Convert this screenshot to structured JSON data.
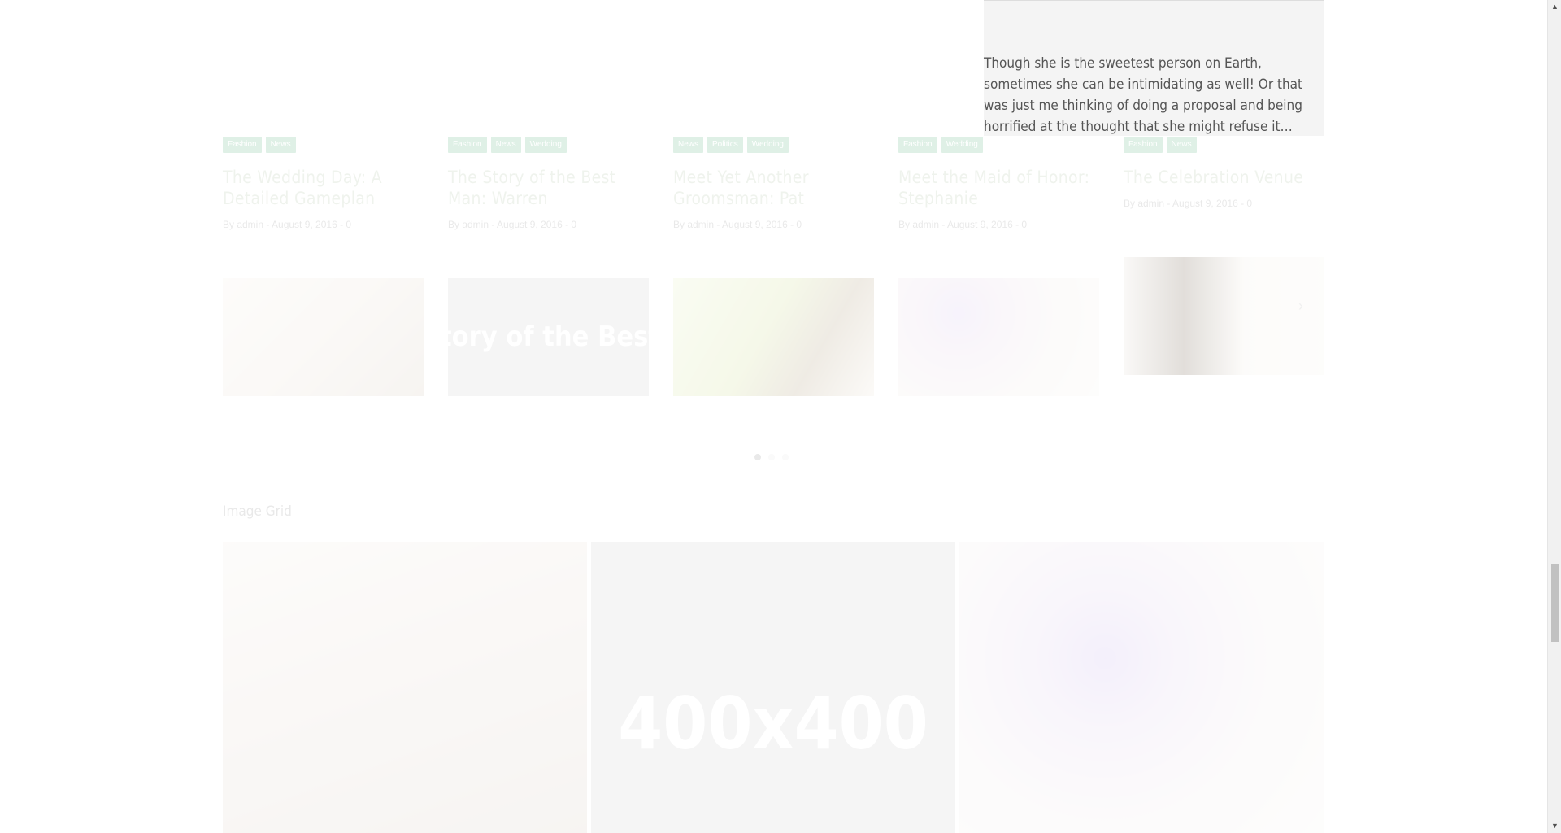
{
  "tooltip": {
    "excerpt": "Though she is the sweetest person on Earth, sometimes she can be intimidating as well! Or that was just me thinking of doing a proposal and being horrified at the thought that she might refuse it…"
  },
  "cards": [
    {
      "tags": [
        "Fashion",
        "News"
      ],
      "title": "The Wedding Day: A Detailed Gameplan",
      "meta": "By admin - August 9, 2016 - 0"
    },
    {
      "tags": [
        "Fashion",
        "News",
        "Wedding"
      ],
      "title": "The Story of the Best Man: Warren",
      "meta": "By admin - August 9, 2016 - 0"
    },
    {
      "tags": [
        "News",
        "Politics",
        "Wedding"
      ],
      "title": "Meet Yet Another Groomsman: Pat",
      "meta": "By admin - August 9, 2016 - 0"
    },
    {
      "tags": [
        "Fashion",
        "Wedding"
      ],
      "title": "Meet the Maid of Honor: Stephanie",
      "meta": "By admin - August 9, 2016 - 0"
    },
    {
      "tags": [
        "Fashion",
        "News"
      ],
      "title": "The Celebration Venue",
      "meta": "By admin - August 9, 2016 - 0"
    }
  ],
  "thumb2_text": "tory of the Best Man: W",
  "section": {
    "title": "Image Grid"
  },
  "grid": {
    "placeholder": "400x400"
  },
  "colors": {
    "tag": "#6cbc8e",
    "accent_title": "#b8c7ae"
  },
  "icons": {
    "scroll_up": "triangle-up",
    "scroll_down": "triangle-down",
    "next": "chevron-right"
  }
}
